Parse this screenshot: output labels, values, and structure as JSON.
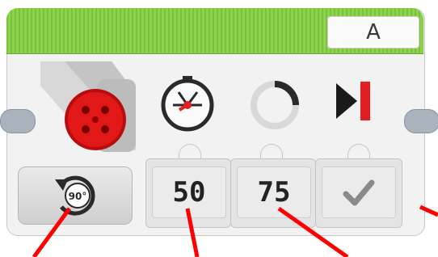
{
  "header": {
    "port_label": "A"
  },
  "icons": {
    "motor": "large-motor-icon",
    "speed": "power-gauge-icon",
    "degrees": "degrees-dial-icon",
    "brake": "brake-at-end-icon",
    "mode": "rotate-degrees-icon",
    "check": "checkmark-icon"
  },
  "mode": {
    "badge_text": "90°"
  },
  "parameters": {
    "power": "50",
    "degrees": "75"
  },
  "colors": {
    "header_green": "#8ed44b",
    "motor_red": "#e01818",
    "annotation_red": "#ff0000",
    "stop_red": "#e02020"
  }
}
